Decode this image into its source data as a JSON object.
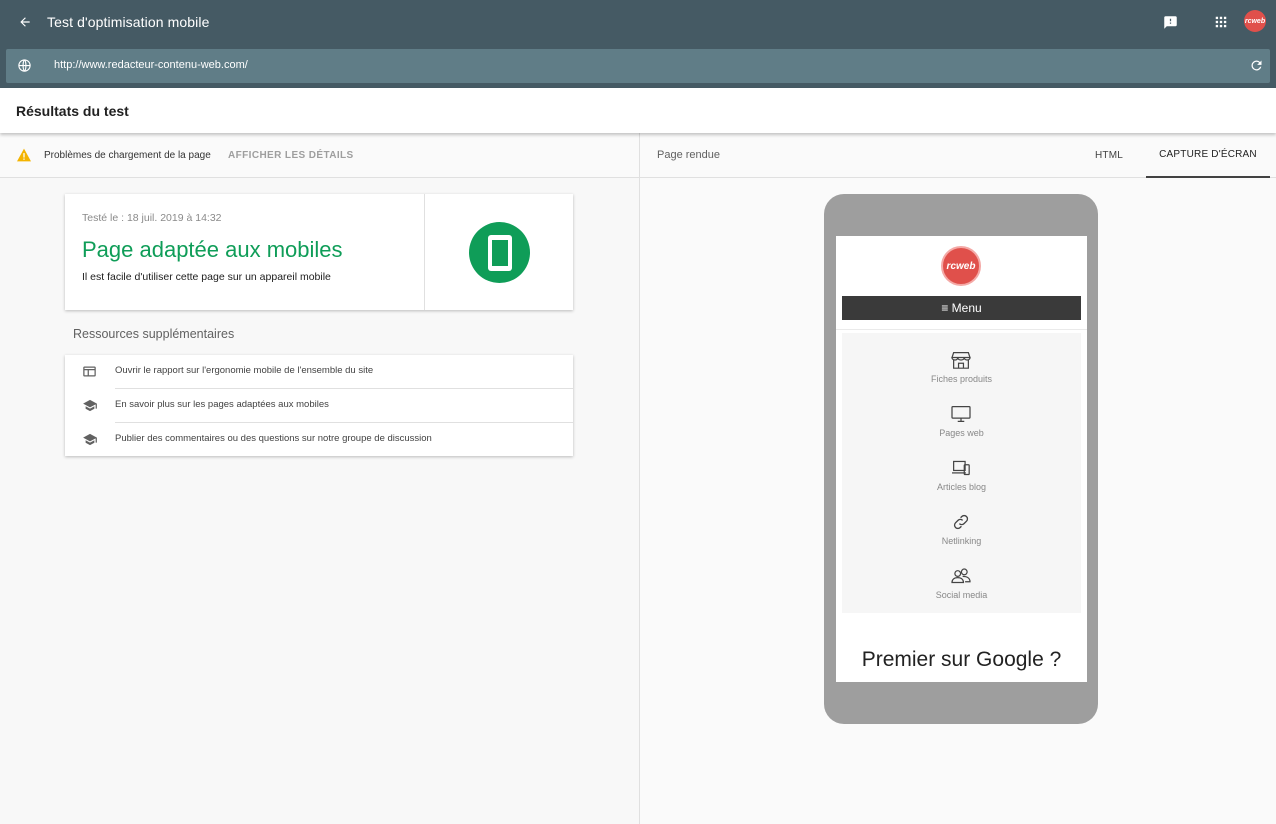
{
  "app": {
    "title": "Test d'optimisation mobile",
    "avatar_text": "rcweb"
  },
  "url": {
    "value": "http://www.redacteur-contenu-web.com/"
  },
  "results": {
    "title": "Résultats du test"
  },
  "issues": {
    "text": "Problèmes de chargement de la page",
    "link": "AFFICHER LES DÉTAILS"
  },
  "result_card": {
    "tested": "Testé le : 18 juil. 2019 à 14:32",
    "verdict": "Page adaptée aux mobiles",
    "description": "Il est facile d'utiliser cette page sur un appareil mobile",
    "accent": "#0f9d58"
  },
  "resources": {
    "title": "Ressources supplémentaires",
    "items": [
      {
        "label": "Ouvrir le rapport sur l'ergonomie mobile de l'ensemble du site",
        "icon": "web-icon"
      },
      {
        "label": "En savoir plus sur les pages adaptées aux mobiles",
        "icon": "school-icon"
      },
      {
        "label": "Publier des commentaires ou des questions sur notre groupe de discussion",
        "icon": "school-icon"
      }
    ]
  },
  "render": {
    "label": "Page rendue",
    "tabs": [
      {
        "label": "HTML"
      },
      {
        "label": "CAPTURE D'ÉCRAN"
      }
    ],
    "active_tab": "CAPTURE D'ÉCRAN"
  },
  "phone_screen": {
    "logo_text": "rcweb",
    "menu_label": "≡ Menu",
    "menu_items": [
      {
        "label": "Fiches produits",
        "icon": "store-icon"
      },
      {
        "label": "Pages web",
        "icon": "monitor-icon"
      },
      {
        "label": "Articles blog",
        "icon": "devices-icon"
      },
      {
        "label": "Netlinking",
        "icon": "link-icon"
      },
      {
        "label": "Social media",
        "icon": "people-icon"
      }
    ],
    "headline": "Premier sur Google ?"
  }
}
